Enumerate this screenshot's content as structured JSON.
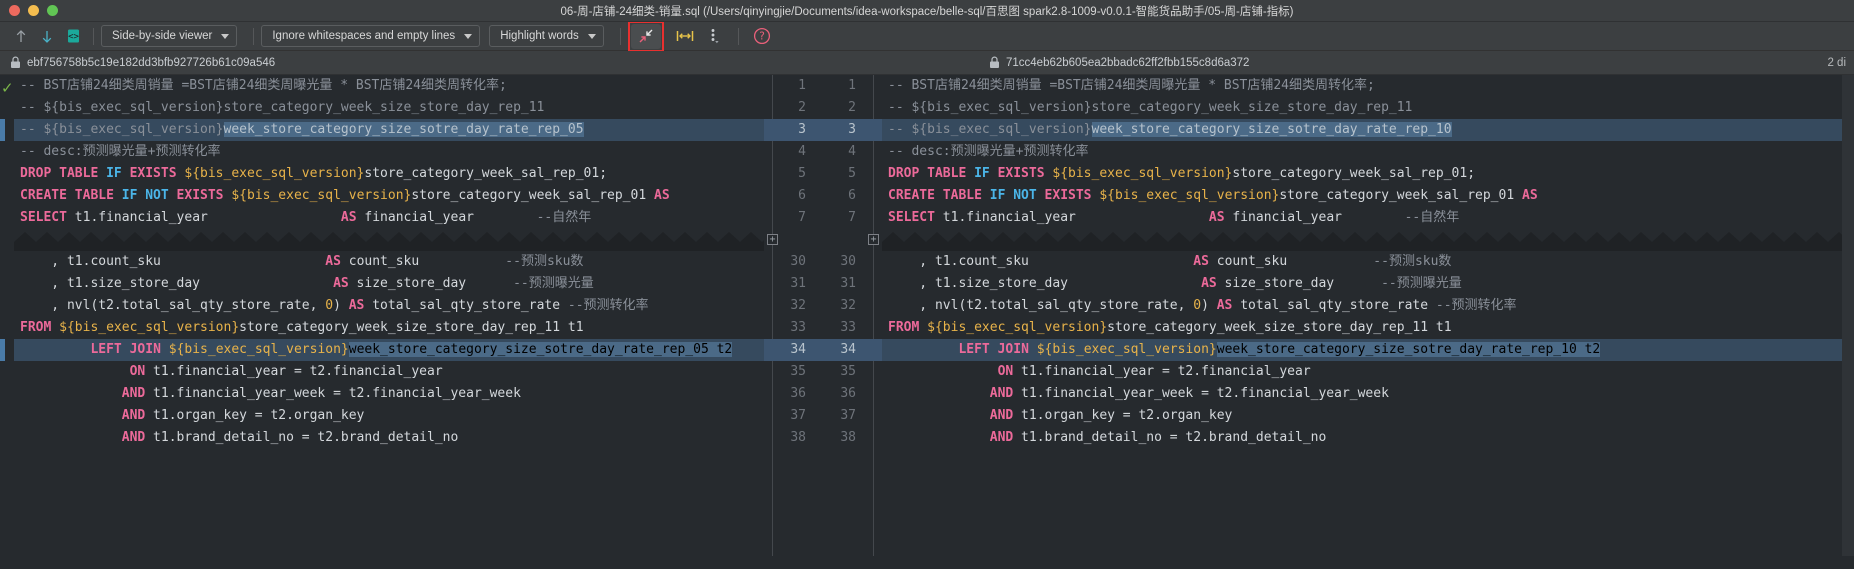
{
  "window": {
    "title": "06-周-店铺-24细类-销量.sql (/Users/qinyingjie/Documents/idea-workspace/belle-sql/百思图 spark2.8-1009-v0.0.1-智能货品助手/05-周-店铺-指标)",
    "traffic_colors": {
      "close": "#ed6a5e",
      "minimize": "#f4bd4f",
      "maximize": "#61c554"
    }
  },
  "toolbar": {
    "prev_diff_icon": "arrow-up-icon",
    "next_diff_icon": "arrow-down-icon",
    "file_icon": "file-compare-icon",
    "viewer_mode": "Side-by-side viewer",
    "whitespace_mode": "Ignore whitespaces and empty lines",
    "highlight_mode": "Highlight words",
    "collapse_icon": "collapse-arrows-icon",
    "expand_icon": "expand-horizontal-icon",
    "more_icon": "more-options-icon",
    "help_icon": "help-circle-icon",
    "highlight_box_color": "#e8302f"
  },
  "revisions": {
    "left_lock_icon": "lock-icon",
    "left_hash": "ebf756758b5c19e182dd3bfb927726b61c09a546",
    "right_lock_icon": "lock-icon",
    "right_hash": "71cc4eb62b605ea2bbadc62ff2fbb155c8d6a372",
    "diff_count": "2 di"
  },
  "gutter": {
    "line_numbers": [
      "1",
      "2",
      "3",
      "4",
      "5",
      "6",
      "7",
      "",
      "30",
      "31",
      "32",
      "33",
      "34",
      "35",
      "36",
      "37",
      "38"
    ],
    "fold_marker": "+",
    "selected_lines": [
      "3",
      "34"
    ]
  },
  "left_pane": {
    "status_icon": "check-ok-icon",
    "lines": [
      {
        "n": "1",
        "sel": false,
        "tokens": [
          {
            "t": "-- BST店铺24细类周销量 =BST店铺24细类周曝光量 * BST店铺24细类周转化率;",
            "c": "cmt"
          }
        ]
      },
      {
        "n": "2",
        "sel": false,
        "tokens": [
          {
            "t": "-- ${bis_exec_sql_version}store_category_week_size_store_day_rep_11",
            "c": "cmt"
          }
        ]
      },
      {
        "n": "3",
        "sel": true,
        "tokens": [
          {
            "t": "-- ${bis_exec_sql_version}",
            "c": "cmt"
          },
          {
            "t": "week_store_category_size_sotre_day_rate_rep_05",
            "c": "hlc"
          }
        ]
      },
      {
        "n": "4",
        "sel": false,
        "tokens": [
          {
            "t": "-- desc:预测曝光量+预测转化率",
            "c": "cmt"
          }
        ]
      },
      {
        "n": "5",
        "sel": false,
        "tokens": [
          {
            "t": "DROP TABLE ",
            "c": "kw"
          },
          {
            "t": "IF",
            "c": "kw2"
          },
          {
            "t": " EXISTS ",
            "c": "kw"
          },
          {
            "t": "${bis_exec_sql_version}",
            "c": "var"
          },
          {
            "t": "store_category_week_sal_rep_01;",
            "c": "plain"
          }
        ]
      },
      {
        "n": "6",
        "sel": false,
        "tokens": [
          {
            "t": "CREATE TABLE ",
            "c": "kw"
          },
          {
            "t": "IF NOT",
            "c": "kw2"
          },
          {
            "t": " EXISTS ",
            "c": "kw"
          },
          {
            "t": "${bis_exec_sql_version}",
            "c": "var"
          },
          {
            "t": "store_category_week_sal_rep_01 ",
            "c": "plain"
          },
          {
            "t": "AS",
            "c": "kw"
          }
        ]
      },
      {
        "n": "7",
        "sel": false,
        "tokens": [
          {
            "t": "SELECT ",
            "c": "kw"
          },
          {
            "t": "t1.financial_year",
            "c": "plain"
          },
          {
            "t": "                 ",
            "c": "plain"
          },
          {
            "t": "AS",
            "c": "kw"
          },
          {
            "t": " financial_year",
            "c": "plain"
          },
          {
            "t": "        ",
            "c": "plain"
          },
          {
            "t": "--自然年",
            "c": "cmt"
          }
        ]
      },
      {
        "n": "",
        "sel": false,
        "fold": true,
        "tokens": []
      },
      {
        "n": "30",
        "sel": false,
        "tokens": [
          {
            "t": "    , t1.count_sku",
            "c": "plain"
          },
          {
            "t": "                     ",
            "c": "plain"
          },
          {
            "t": "AS",
            "c": "kw"
          },
          {
            "t": " count_sku",
            "c": "plain"
          },
          {
            "t": "           ",
            "c": "plain"
          },
          {
            "t": "--预测sku数",
            "c": "cmt"
          }
        ]
      },
      {
        "n": "31",
        "sel": false,
        "tokens": [
          {
            "t": "    , t1.size_store_day",
            "c": "plain"
          },
          {
            "t": "                 ",
            "c": "plain"
          },
          {
            "t": "AS",
            "c": "kw"
          },
          {
            "t": " size_store_day",
            "c": "plain"
          },
          {
            "t": "      ",
            "c": "plain"
          },
          {
            "t": "--预测曝光量",
            "c": "cmt"
          }
        ]
      },
      {
        "n": "32",
        "sel": false,
        "tokens": [
          {
            "t": "    , nvl(t2.total_sal_qty_store_rate, ",
            "c": "plain"
          },
          {
            "t": "0",
            "c": "num"
          },
          {
            "t": ") ",
            "c": "plain"
          },
          {
            "t": "AS",
            "c": "kw"
          },
          {
            "t": " total_sal_qty_store_rate ",
            "c": "plain"
          },
          {
            "t": "--预测转化率",
            "c": "cmt"
          }
        ]
      },
      {
        "n": "33",
        "sel": false,
        "tokens": [
          {
            "t": "FROM ",
            "c": "kw"
          },
          {
            "t": "${bis_exec_sql_version}",
            "c": "var"
          },
          {
            "t": "store_category_week_size_store_day_rep_11 t1",
            "c": "plain"
          }
        ]
      },
      {
        "n": "34",
        "sel": true,
        "tokens": [
          {
            "t": "         ",
            "c": "plain"
          },
          {
            "t": "LEFT JOIN ",
            "c": "kw"
          },
          {
            "t": "${bis_exec_sql_version}",
            "c": "var"
          },
          {
            "t": "week_store_category_size_sotre_day_rate_rep_05 t2",
            "c": "hl"
          }
        ]
      },
      {
        "n": "35",
        "sel": false,
        "tokens": [
          {
            "t": "              ",
            "c": "plain"
          },
          {
            "t": "ON",
            "c": "kw"
          },
          {
            "t": " t1.financial_year = t2.financial_year",
            "c": "plain"
          }
        ]
      },
      {
        "n": "36",
        "sel": false,
        "tokens": [
          {
            "t": "             ",
            "c": "plain"
          },
          {
            "t": "AND",
            "c": "kw"
          },
          {
            "t": " t1.financial_year_week = t2.financial_year_week",
            "c": "plain"
          }
        ]
      },
      {
        "n": "37",
        "sel": false,
        "tokens": [
          {
            "t": "             ",
            "c": "plain"
          },
          {
            "t": "AND",
            "c": "kw"
          },
          {
            "t": " t1.organ_key = t2.organ_key",
            "c": "plain"
          }
        ]
      },
      {
        "n": "38",
        "sel": false,
        "tokens": [
          {
            "t": "             ",
            "c": "plain"
          },
          {
            "t": "AND",
            "c": "kw"
          },
          {
            "t": " t1.brand_detail_no = t2.brand_detail_no",
            "c": "plain"
          }
        ]
      }
    ]
  },
  "right_pane": {
    "lines": [
      {
        "n": "1",
        "sel": false,
        "tokens": [
          {
            "t": "-- BST店铺24细类周销量 =BST店铺24细类周曝光量 * BST店铺24细类周转化率;",
            "c": "cmt"
          }
        ]
      },
      {
        "n": "2",
        "sel": false,
        "tokens": [
          {
            "t": "-- ${bis_exec_sql_version}store_category_week_size_store_day_rep_11",
            "c": "cmt"
          }
        ]
      },
      {
        "n": "3",
        "sel": true,
        "tokens": [
          {
            "t": "-- ${bis_exec_sql_version}",
            "c": "cmt"
          },
          {
            "t": "week_store_category_size_sotre_day_rate_rep_10",
            "c": "hlc"
          }
        ]
      },
      {
        "n": "4",
        "sel": false,
        "tokens": [
          {
            "t": "-- desc:预测曝光量+预测转化率",
            "c": "cmt"
          }
        ]
      },
      {
        "n": "5",
        "sel": false,
        "tokens": [
          {
            "t": "DROP TABLE ",
            "c": "kw"
          },
          {
            "t": "IF",
            "c": "kw2"
          },
          {
            "t": " EXISTS ",
            "c": "kw"
          },
          {
            "t": "${bis_exec_sql_version}",
            "c": "var"
          },
          {
            "t": "store_category_week_sal_rep_01;",
            "c": "plain"
          }
        ]
      },
      {
        "n": "6",
        "sel": false,
        "tokens": [
          {
            "t": "CREATE TABLE ",
            "c": "kw"
          },
          {
            "t": "IF NOT",
            "c": "kw2"
          },
          {
            "t": " EXISTS ",
            "c": "kw"
          },
          {
            "t": "${bis_exec_sql_version}",
            "c": "var"
          },
          {
            "t": "store_category_week_sal_rep_01 ",
            "c": "plain"
          },
          {
            "t": "AS",
            "c": "kw"
          }
        ]
      },
      {
        "n": "7",
        "sel": false,
        "tokens": [
          {
            "t": "SELECT ",
            "c": "kw"
          },
          {
            "t": "t1.financial_year",
            "c": "plain"
          },
          {
            "t": "                 ",
            "c": "plain"
          },
          {
            "t": "AS",
            "c": "kw"
          },
          {
            "t": " financial_year",
            "c": "plain"
          },
          {
            "t": "        ",
            "c": "plain"
          },
          {
            "t": "--自然年",
            "c": "cmt"
          }
        ]
      },
      {
        "n": "",
        "sel": false,
        "fold": true,
        "tokens": []
      },
      {
        "n": "30",
        "sel": false,
        "tokens": [
          {
            "t": "    , t1.count_sku",
            "c": "plain"
          },
          {
            "t": "                     ",
            "c": "plain"
          },
          {
            "t": "AS",
            "c": "kw"
          },
          {
            "t": " count_sku",
            "c": "plain"
          },
          {
            "t": "           ",
            "c": "plain"
          },
          {
            "t": "--预测sku数",
            "c": "cmt"
          }
        ]
      },
      {
        "n": "31",
        "sel": false,
        "tokens": [
          {
            "t": "    , t1.size_store_day",
            "c": "plain"
          },
          {
            "t": "                 ",
            "c": "plain"
          },
          {
            "t": "AS",
            "c": "kw"
          },
          {
            "t": " size_store_day",
            "c": "plain"
          },
          {
            "t": "      ",
            "c": "plain"
          },
          {
            "t": "--预测曝光量",
            "c": "cmt"
          }
        ]
      },
      {
        "n": "32",
        "sel": false,
        "tokens": [
          {
            "t": "    , nvl(t2.total_sal_qty_store_rate, ",
            "c": "plain"
          },
          {
            "t": "0",
            "c": "num"
          },
          {
            "t": ") ",
            "c": "plain"
          },
          {
            "t": "AS",
            "c": "kw"
          },
          {
            "t": " total_sal_qty_store_rate ",
            "c": "plain"
          },
          {
            "t": "--预测转化率",
            "c": "cmt"
          }
        ]
      },
      {
        "n": "33",
        "sel": false,
        "tokens": [
          {
            "t": "FROM ",
            "c": "kw"
          },
          {
            "t": "${bis_exec_sql_version}",
            "c": "var"
          },
          {
            "t": "store_category_week_size_store_day_rep_11 t1",
            "c": "plain"
          }
        ]
      },
      {
        "n": "34",
        "sel": true,
        "tokens": [
          {
            "t": "         ",
            "c": "plain"
          },
          {
            "t": "LEFT JOIN ",
            "c": "kw"
          },
          {
            "t": "${bis_exec_sql_version}",
            "c": "var"
          },
          {
            "t": "week_store_category_size_sotre_day_rate_rep_10 t2",
            "c": "hl"
          }
        ]
      },
      {
        "n": "35",
        "sel": false,
        "tokens": [
          {
            "t": "              ",
            "c": "plain"
          },
          {
            "t": "ON",
            "c": "kw"
          },
          {
            "t": " t1.financial_year = t2.financial_year",
            "c": "plain"
          }
        ]
      },
      {
        "n": "36",
        "sel": false,
        "tokens": [
          {
            "t": "             ",
            "c": "plain"
          },
          {
            "t": "AND",
            "c": "kw"
          },
          {
            "t": " t1.financial_year_week = t2.financial_year_week",
            "c": "plain"
          }
        ]
      },
      {
        "n": "37",
        "sel": false,
        "tokens": [
          {
            "t": "             ",
            "c": "plain"
          },
          {
            "t": "AND",
            "c": "kw"
          },
          {
            "t": " t1.organ_key = t2.organ_key",
            "c": "plain"
          }
        ]
      },
      {
        "n": "38",
        "sel": false,
        "tokens": [
          {
            "t": "             ",
            "c": "plain"
          },
          {
            "t": "AND",
            "c": "kw"
          },
          {
            "t": " t1.brand_detail_no = t2.brand_detail_no",
            "c": "plain"
          }
        ]
      }
    ]
  },
  "colors": {
    "bg_editor": "#262a2e",
    "bg_chrome": "#3c3f41",
    "selection": "#364a5e",
    "word_highlight": "#4b6a87",
    "keyword": "#ec6a9a",
    "type_keyword": "#4bb5e8",
    "variable": "#e8b34a",
    "comment": "#8a9099",
    "text": "#d4d8dc"
  }
}
